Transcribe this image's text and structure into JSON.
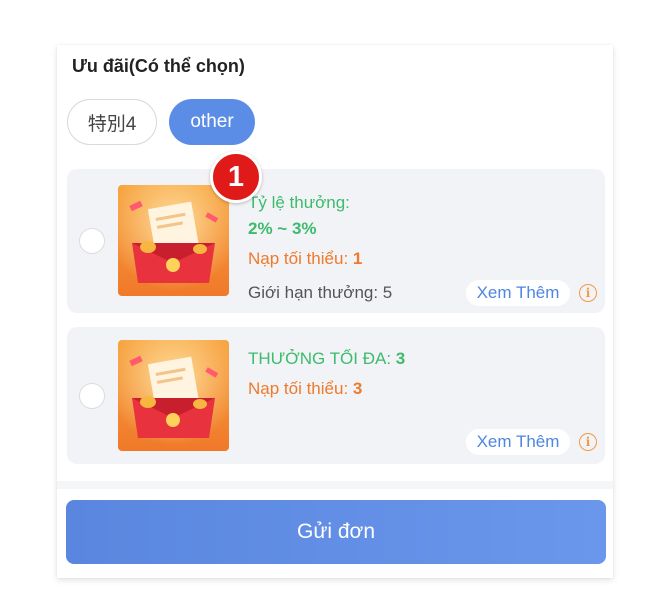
{
  "section": {
    "title": "Ưu đãi(Có thể chọn)"
  },
  "tabs": [
    {
      "label": "特別4"
    },
    {
      "label": "other"
    }
  ],
  "badge": {
    "number": "1"
  },
  "cards": [
    {
      "rate_label": "Tỷ lệ thưởng:",
      "rate_value": "2% ~ 3%",
      "min_deposit_label": "Nạp tối thiểu: ",
      "min_deposit_value": "1",
      "limit_label": "Giới hạn thưởng: ",
      "limit_value": "5",
      "more_label": "Xem Thêm"
    },
    {
      "max_bonus_label": "THƯỞNG TỐI ĐA: ",
      "max_bonus_value": "3",
      "min_deposit_label": "Nạp tối thiểu: ",
      "min_deposit_value": "3",
      "more_label": "Xem Thêm"
    }
  ],
  "submit": {
    "label": "Gửi đơn"
  },
  "colors": {
    "accent_blue": "#5b8de6",
    "bonus_green": "#3dbb6d",
    "deposit_orange": "#ee7a2c",
    "badge_red": "#e01919"
  },
  "icons": {
    "info": "info-circle-icon",
    "thumbnail": "red-envelope-gift-illustration"
  }
}
